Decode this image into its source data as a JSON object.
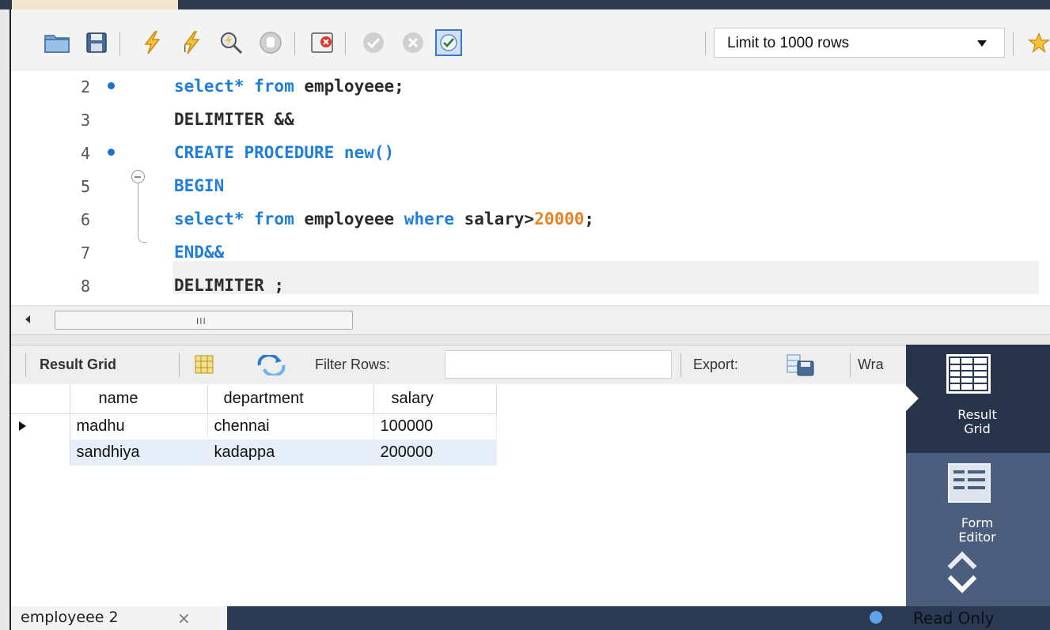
{
  "toolbar": {
    "limit_value": "Limit to 1000 rows",
    "icons": [
      "open-folder-icon",
      "save-icon",
      "execute-icon",
      "execute-current-icon",
      "explain-icon",
      "stop-icon",
      "toggle-error-icon",
      "commit-icon",
      "rollback-icon",
      "autocommit-icon",
      "dropdown-arrow-icon",
      "bookmark-star-icon"
    ]
  },
  "editor": {
    "lines": [
      {
        "num": "2",
        "marker": true
      },
      {
        "num": "3",
        "marker": false
      },
      {
        "num": "4",
        "marker": true
      },
      {
        "num": "5",
        "marker": false
      },
      {
        "num": "6",
        "marker": false
      },
      {
        "num": "7",
        "marker": false
      },
      {
        "num": "8",
        "marker": false
      }
    ],
    "tokens": {
      "l2_kw1": "select* from",
      "l2_rest": " employeee;",
      "l3": "DELIMITER &&",
      "l4": "CREATE PROCEDURE new()",
      "l5": "BEGIN",
      "l6_kw1": "select* from",
      "l6_mid": " employeee ",
      "l6_kw2": "where",
      "l6_rest": " salary>",
      "l6_num": "20000",
      "l6_end": ";",
      "l7": "END&&",
      "l8": "DELIMITER ;"
    }
  },
  "hscroll": {
    "grip": "III"
  },
  "result_toolbar": {
    "result_grid": "Result Grid",
    "filter_rows": "Filter Rows:",
    "filter_value": "",
    "export": "Export:",
    "wrap": "Wra"
  },
  "grid": {
    "columns": [
      "name",
      "department",
      "salary"
    ],
    "rows": [
      [
        "madhu",
        "chennai",
        "100000"
      ],
      [
        "sandhiya",
        "kadappa",
        "200000"
      ]
    ]
  },
  "side_panel": {
    "result_grid": [
      "Result",
      "Grid"
    ],
    "form_editor": [
      "Form",
      "Editor"
    ]
  },
  "status": {
    "tab_label": "employeee 2",
    "close": "×",
    "read_only": "Read Only"
  },
  "colors": {
    "keyword": "#1f7fd8",
    "number": "#e98326",
    "panel": "#2b3a52",
    "panel_active": "#4b5e7e"
  }
}
